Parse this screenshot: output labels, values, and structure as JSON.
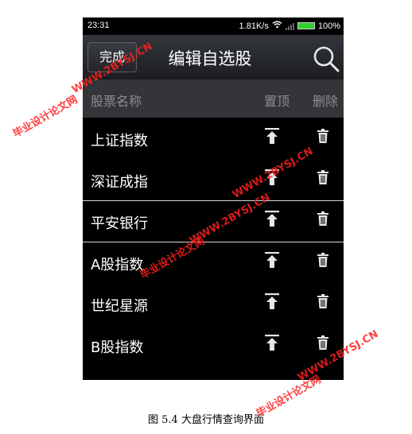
{
  "status": {
    "time": "23:31",
    "speed": "1.81K/s",
    "battery": "100%"
  },
  "nav": {
    "back_label": "完成",
    "title": "编辑自选股"
  },
  "columns": {
    "name": "股票名称",
    "pin": "置顶",
    "delete": "删除"
  },
  "stocks": [
    {
      "name": "上证指数"
    },
    {
      "name": "深证成指"
    },
    {
      "name": "平安银行"
    },
    {
      "name": "A股指数"
    },
    {
      "name": "世纪星源"
    },
    {
      "name": "B股指数"
    }
  ],
  "caption": "图 5.4 大盘行情查询界面",
  "watermarks": [
    {
      "text": "WWW.2BYSJ.CN"
    },
    {
      "text": "毕业设计论文网"
    },
    {
      "text": "WWW.2BYSJ.CN"
    },
    {
      "text": "毕业设计论文网"
    },
    {
      "text": "WWW.2BYSJ.CN"
    },
    {
      "text": "毕业设计论文网"
    },
    {
      "text": "WWW.2BYSJ.CN"
    }
  ],
  "colors": {
    "accent_text": "#ffffff",
    "header_bg": "#333538",
    "watermark": "#ff2020"
  }
}
